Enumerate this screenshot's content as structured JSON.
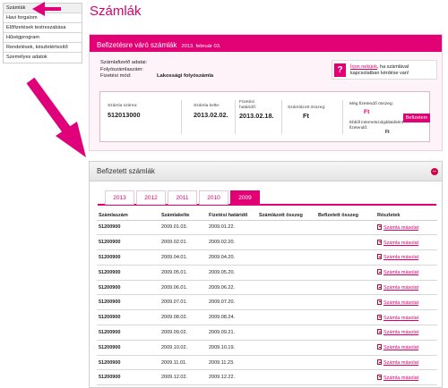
{
  "nav": {
    "items": [
      {
        "label": "Számlák",
        "active": true
      },
      {
        "label": "Havi forgalom"
      },
      {
        "label": "Előfizetések testreszabása"
      },
      {
        "label": "Hűségprogram"
      },
      {
        "label": "Rendelések, készletértesítő"
      },
      {
        "label": "Személyes adatok"
      }
    ]
  },
  "page": {
    "title": "Számlák"
  },
  "pending": {
    "header": "Befizetésre váró számlák",
    "date": "2013. február 03.",
    "payer": {
      "data_label": "Számlafizető adatai:",
      "account_label": "Folyószámlaszám:",
      "method_label": "Fizetési mód:",
      "method_value": "Lakossági folyószámla"
    },
    "help": {
      "icon": "?",
      "link": "Írjon nekünk",
      "text": ", ha számlával kapcsolatban kérdése van!"
    },
    "bill": {
      "number_label": "Számla száma:",
      "number": "512013000",
      "date_label": "Számla kelte:",
      "date": "2013.02.02.",
      "due_label_1": "Fizetési",
      "due_label_2": "határidő:",
      "due": "2013.02.18.",
      "billed_label": "Számlázott összeg:",
      "billed": "Ft",
      "remaining_label": "Még fizetendő összeg:",
      "remaining": "Ft",
      "inet_label": "Ebből internetszolgáltatóként fizetendő:",
      "inet_value": "Ft",
      "pay_button": "Befizetem"
    }
  },
  "paid": {
    "header": "Befizetett számlák",
    "collapse": "−",
    "tabs": [
      "2013",
      "2012",
      "2011",
      "2010",
      "2009"
    ],
    "active_tab": "2009",
    "columns": [
      "Számlaszám",
      "Számlakelte",
      "Fizetési határidő",
      "Számlázott összeg",
      "Befizetett összeg",
      "Részletek"
    ],
    "copy_label": "Számla másolat",
    "rows": [
      {
        "num": "51200900",
        "date": "2009.01.03.",
        "due": "2009.01.22."
      },
      {
        "num": "51200900",
        "date": "2009.02.01.",
        "due": "2009.02.20."
      },
      {
        "num": "51200900",
        "date": "2009.04.01.",
        "due": "2009.04.20."
      },
      {
        "num": "51200900",
        "date": "2009.05.01.",
        "due": "2009.05.20."
      },
      {
        "num": "51200900",
        "date": "2009.06.01.",
        "due": "2009.06.22."
      },
      {
        "num": "51200900",
        "date": "2009.07.01.",
        "due": "2009.07.20."
      },
      {
        "num": "51200900",
        "date": "2009.08.02.",
        "due": "2009.08.24."
      },
      {
        "num": "51200900",
        "date": "2009.09.02.",
        "due": "2009.09.21."
      },
      {
        "num": "51200900",
        "date": "2009.10.02.",
        "due": "2009.10.19."
      },
      {
        "num": "51200900",
        "date": "2009.11.01.",
        "due": "2009.11.23."
      },
      {
        "num": "51200900",
        "date": "2009.12.02.",
        "due": "2009.12.22."
      }
    ]
  },
  "colors": {
    "accent": "#e20074",
    "link": "#d6006f"
  }
}
